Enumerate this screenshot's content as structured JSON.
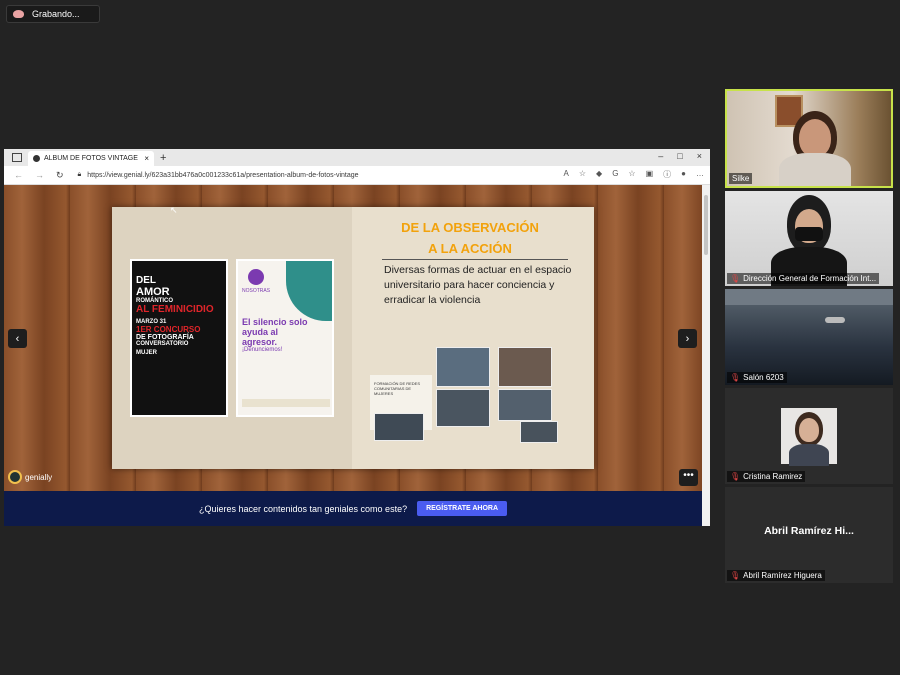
{
  "recording": {
    "label": "Grabando..."
  },
  "browser": {
    "tab_title": "ÁLBUM DE FOTOS VINTAGE por",
    "tab_close": "×",
    "new_tab": "+",
    "window_controls": [
      "–",
      "□",
      "×"
    ],
    "url": "https://view.genial.ly/623a31bb476a0c001233c61a/presentation-album-de-fotos-vintage"
  },
  "slide": {
    "title_line1": "DE LA OBSERVACIÓN",
    "title_line2": "A LA ACCIÓN",
    "body": "Diversas formas de actuar en el espacio universitario para hacer conciencia y erradicar la violencia",
    "poster1": {
      "line1": "DEL",
      "line2": "AMOR",
      "line3": "ROMÁNTICO",
      "line4": "AL FEMINICIDIO",
      "date": "MARZO 31",
      "line5": "1ER CONCURSO",
      "line6": "DE FOTOGRAFÍA",
      "line7": "CONVERSATORIO",
      "line8": "MUJER"
    },
    "poster2": {
      "org": "NOSOTRAS",
      "headline": "El silencio solo ayuda al agresor.",
      "sub": "¡Denunciemos!"
    },
    "collage_caption": "FORMACIÓN DE REDES COMUNITARIAS DE MUJERES"
  },
  "viewer": {
    "brand": "genially",
    "cta_text": "¿Quieres hacer contenidos tan geniales como este?",
    "cta_button": "REGÍSTRATE AHORA"
  },
  "participants": [
    {
      "name": "Silke",
      "muted": false,
      "active": true
    },
    {
      "name": "Dirección General de Formación Int...",
      "muted": true
    },
    {
      "name": "Salón 6203",
      "muted": true
    },
    {
      "name": "Cristina Ramirez",
      "muted": true
    },
    {
      "name": "Abril Ramírez Higuera",
      "display": "Abril Ramírez Hi...",
      "muted": true
    }
  ],
  "colors": {
    "accent_title": "#f2a20c",
    "cta_bar": "#0d1a4a",
    "cta_button": "#4a5cf0",
    "active_speaker": "#c7e24a"
  }
}
